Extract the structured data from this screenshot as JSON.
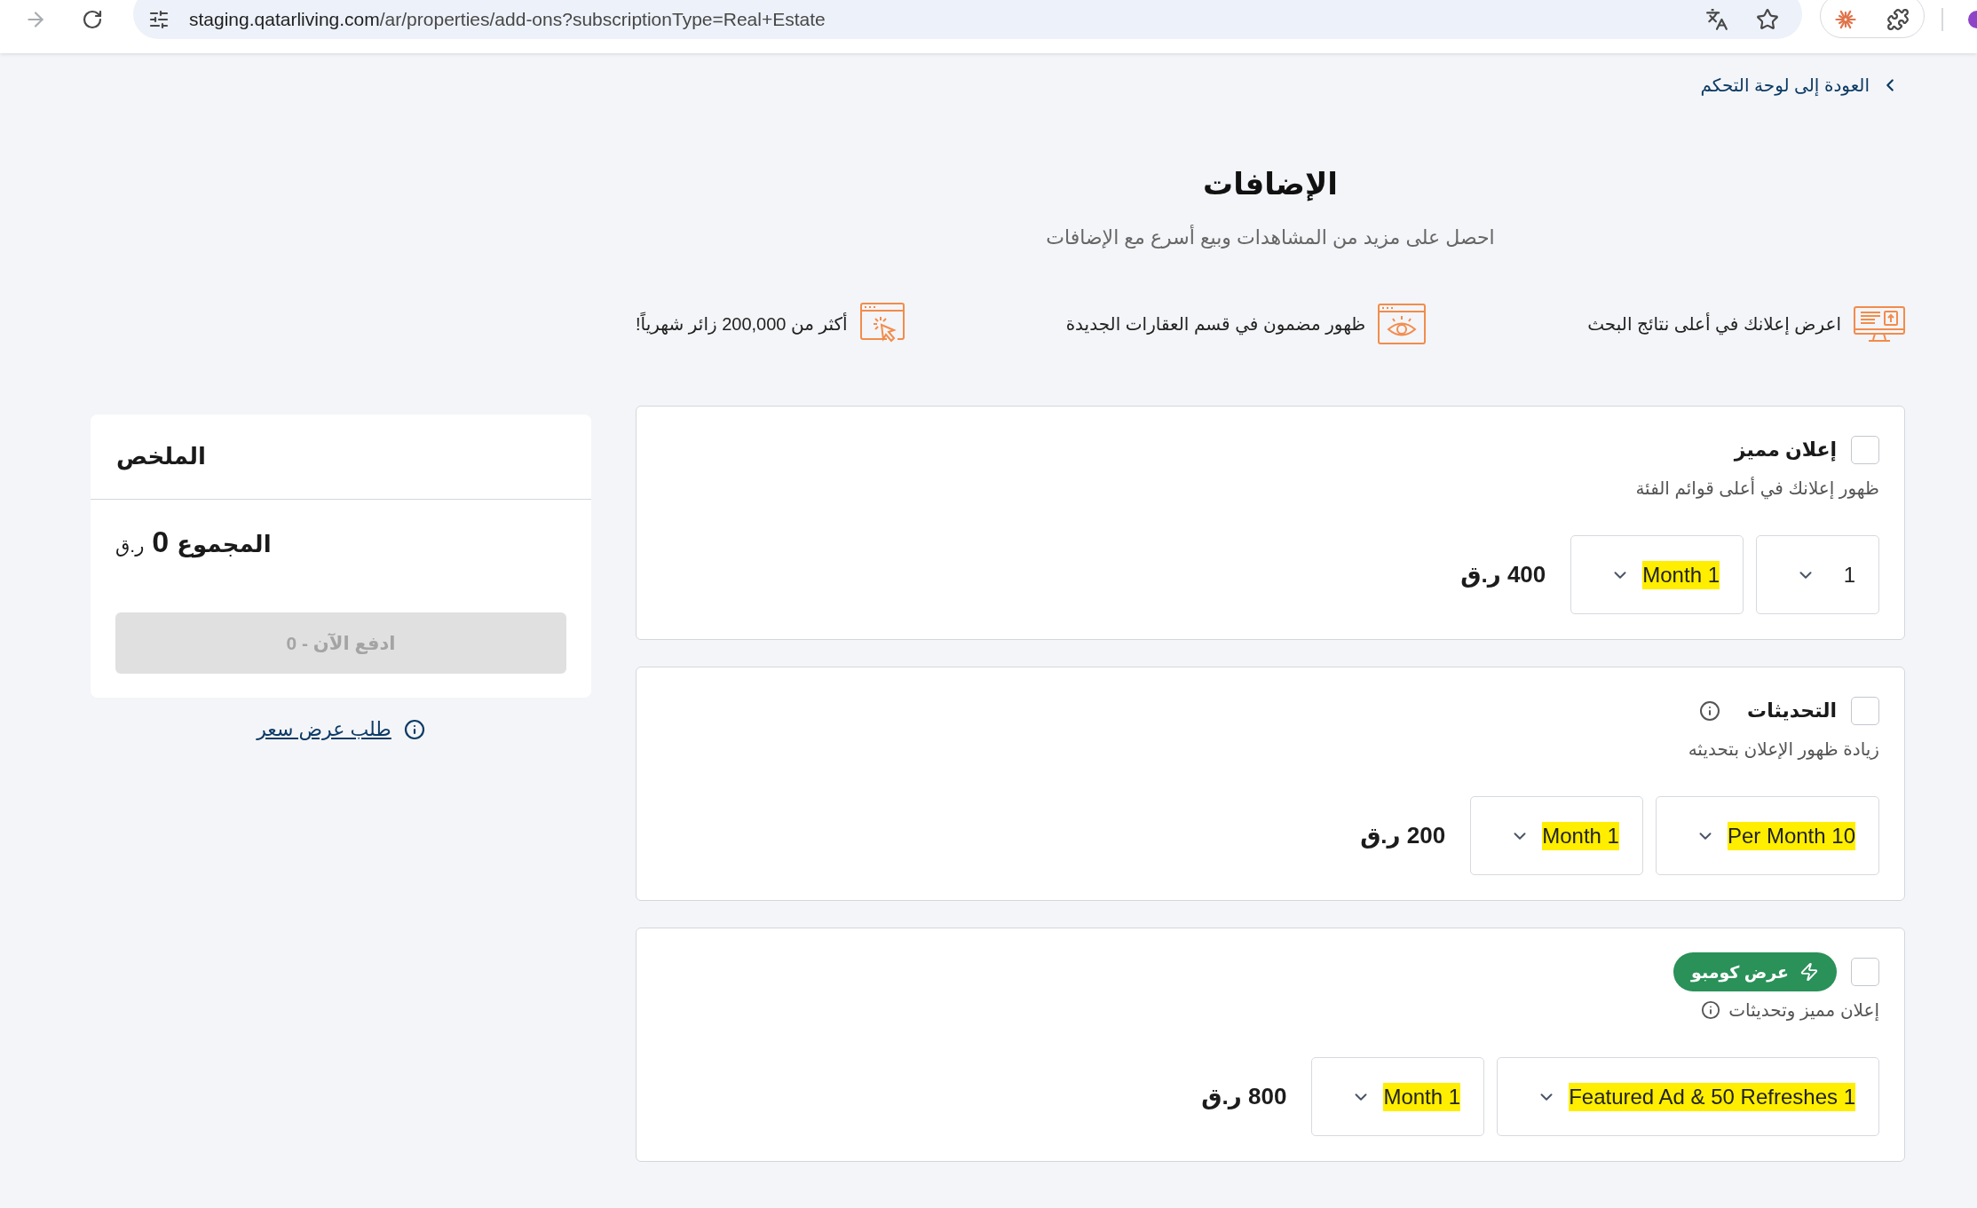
{
  "browser": {
    "url_host": "staging.qatarliving.com",
    "url_path": "/ar/properties/add-ons?subscriptionType=Real+Estate"
  },
  "back_link": "العودة إلى لوحة التحكم",
  "header": {
    "title": "الإضافات",
    "subtitle": "احصل على مزيد من المشاهدات وبيع أسرع مع الإضافات"
  },
  "features": [
    "اعرض إعلانك في أعلى نتائج البحث",
    "ظهور مضمون في قسم العقارات الجديدة",
    "أكثر من 200,000 زائر شهرياً!"
  ],
  "addons": [
    {
      "checked": false,
      "title": "إعلان مميز",
      "title_info": false,
      "description": "ظهور إعلانك في أعلى قوائم الفئة",
      "description_info": false,
      "selects": [
        {
          "value": "1",
          "highlighted": false
        },
        {
          "value": "Month 1",
          "highlighted": true
        }
      ],
      "price": "400 ر.ق"
    },
    {
      "checked": false,
      "title": "التحديثات",
      "title_info": true,
      "description": "زيادة ظهور الإعلان بتحديثه",
      "description_info": false,
      "selects": [
        {
          "value": "Per Month 10",
          "highlighted": true
        },
        {
          "value": "Month 1",
          "highlighted": true
        }
      ],
      "price": "200 ر.ق"
    },
    {
      "checked": false,
      "badge": "عرض كومبو",
      "title_info": false,
      "description": "إعلان مميز وتحديثات",
      "description_info": true,
      "selects": [
        {
          "value": "Featured Ad & 50 Refreshes 1",
          "highlighted": true
        },
        {
          "value": "Month 1",
          "highlighted": true
        }
      ],
      "price": "800 ر.ق"
    }
  ],
  "summary": {
    "title": "الملخص",
    "total_label": "المجموع",
    "total_amount": "0",
    "total_currency": "ر.ق",
    "pay_button": {
      "label": "ادفع الآن - 0",
      "disabled": true
    },
    "quote_link": "طلب عرض سعر"
  }
}
